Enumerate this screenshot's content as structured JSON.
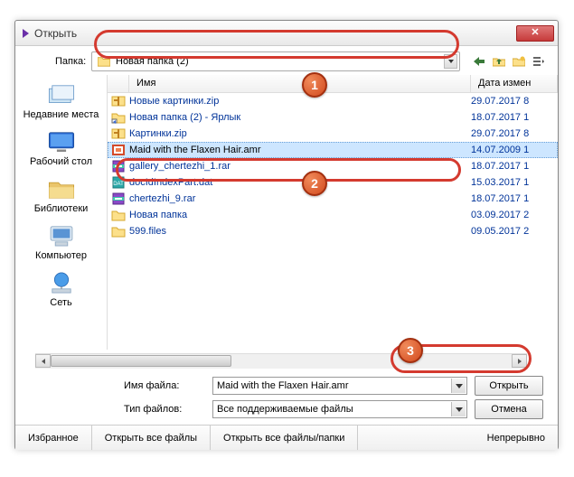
{
  "window": {
    "title": "Открыть"
  },
  "topbar": {
    "folder_label": "Папка:",
    "current_folder": "Новая папка (2)"
  },
  "places": [
    {
      "key": "recent",
      "label": "Недавние места"
    },
    {
      "key": "desktop",
      "label": "Рабочий стол"
    },
    {
      "key": "libraries",
      "label": "Библиотеки"
    },
    {
      "key": "computer",
      "label": "Компьютер"
    },
    {
      "key": "network",
      "label": "Сеть"
    }
  ],
  "columns": {
    "name": "Имя",
    "date": "Дата измен"
  },
  "files": [
    {
      "icon": "zip",
      "name": "Новые картинки.zip",
      "date": "29.07.2017 8",
      "selected": false
    },
    {
      "icon": "shortcut",
      "name": "Новая папка (2) - Ярлык",
      "date": "18.07.2017 1",
      "selected": false
    },
    {
      "icon": "zip",
      "name": "Картинки.zip",
      "date": "29.07.2017 8",
      "selected": false
    },
    {
      "icon": "amr",
      "name": "Maid with the Flaxen Hair.amr",
      "date": "14.07.2009 1",
      "selected": true
    },
    {
      "icon": "rar",
      "name": "gallery_chertezhi_1.rar",
      "date": "18.07.2017 1",
      "selected": false
    },
    {
      "icon": "dat",
      "name": "docIdIndexPart.dat",
      "date": "15.03.2017 1",
      "selected": false
    },
    {
      "icon": "rar",
      "name": "chertezhi_9.rar",
      "date": "18.07.2017 1",
      "selected": false
    },
    {
      "icon": "folder",
      "name": "Новая папка",
      "date": "03.09.2017 2",
      "selected": false
    },
    {
      "icon": "folder",
      "name": "599.files",
      "date": "09.05.2017 2",
      "selected": false
    }
  ],
  "fields": {
    "filename_label": "Имя файла:",
    "filename_value": "Maid with the Flaxen Hair.amr",
    "filetype_label": "Тип файлов:",
    "filetype_value": "Все поддерживаемые файлы"
  },
  "buttons": {
    "open": "Открыть",
    "cancel": "Отмена"
  },
  "bottombar": {
    "fav": "Избранное",
    "open_all": "Открыть все файлы",
    "open_all_folders": "Открыть все файлы/папки",
    "continuous": "Непрерывно"
  },
  "badges": {
    "b1": "1",
    "b2": "2",
    "b3": "3"
  }
}
